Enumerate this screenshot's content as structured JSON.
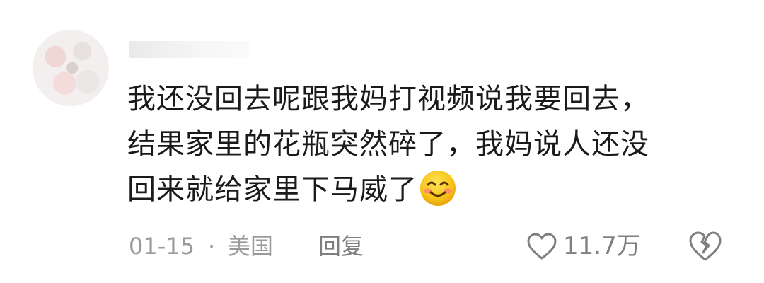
{
  "comment": {
    "username": "",
    "text_line1": "我还没回去呢跟我妈打视频说我要回去，",
    "text_line2": "结果家里的花瓶突然碎了，我妈说人还没",
    "text_line3": "回来就给家里下马威了",
    "emoji": "smiling-face-emoji",
    "date": "01-15",
    "separator": "·",
    "location": "美国",
    "reply_label": "回复",
    "like_count": "11.7万",
    "icons": {
      "like": "heart-outline-icon",
      "dislike": "broken-heart-icon"
    },
    "colors": {
      "text": "#1a1a1a",
      "meta": "#9a9a9a",
      "icon": "#7f7f7f"
    }
  }
}
